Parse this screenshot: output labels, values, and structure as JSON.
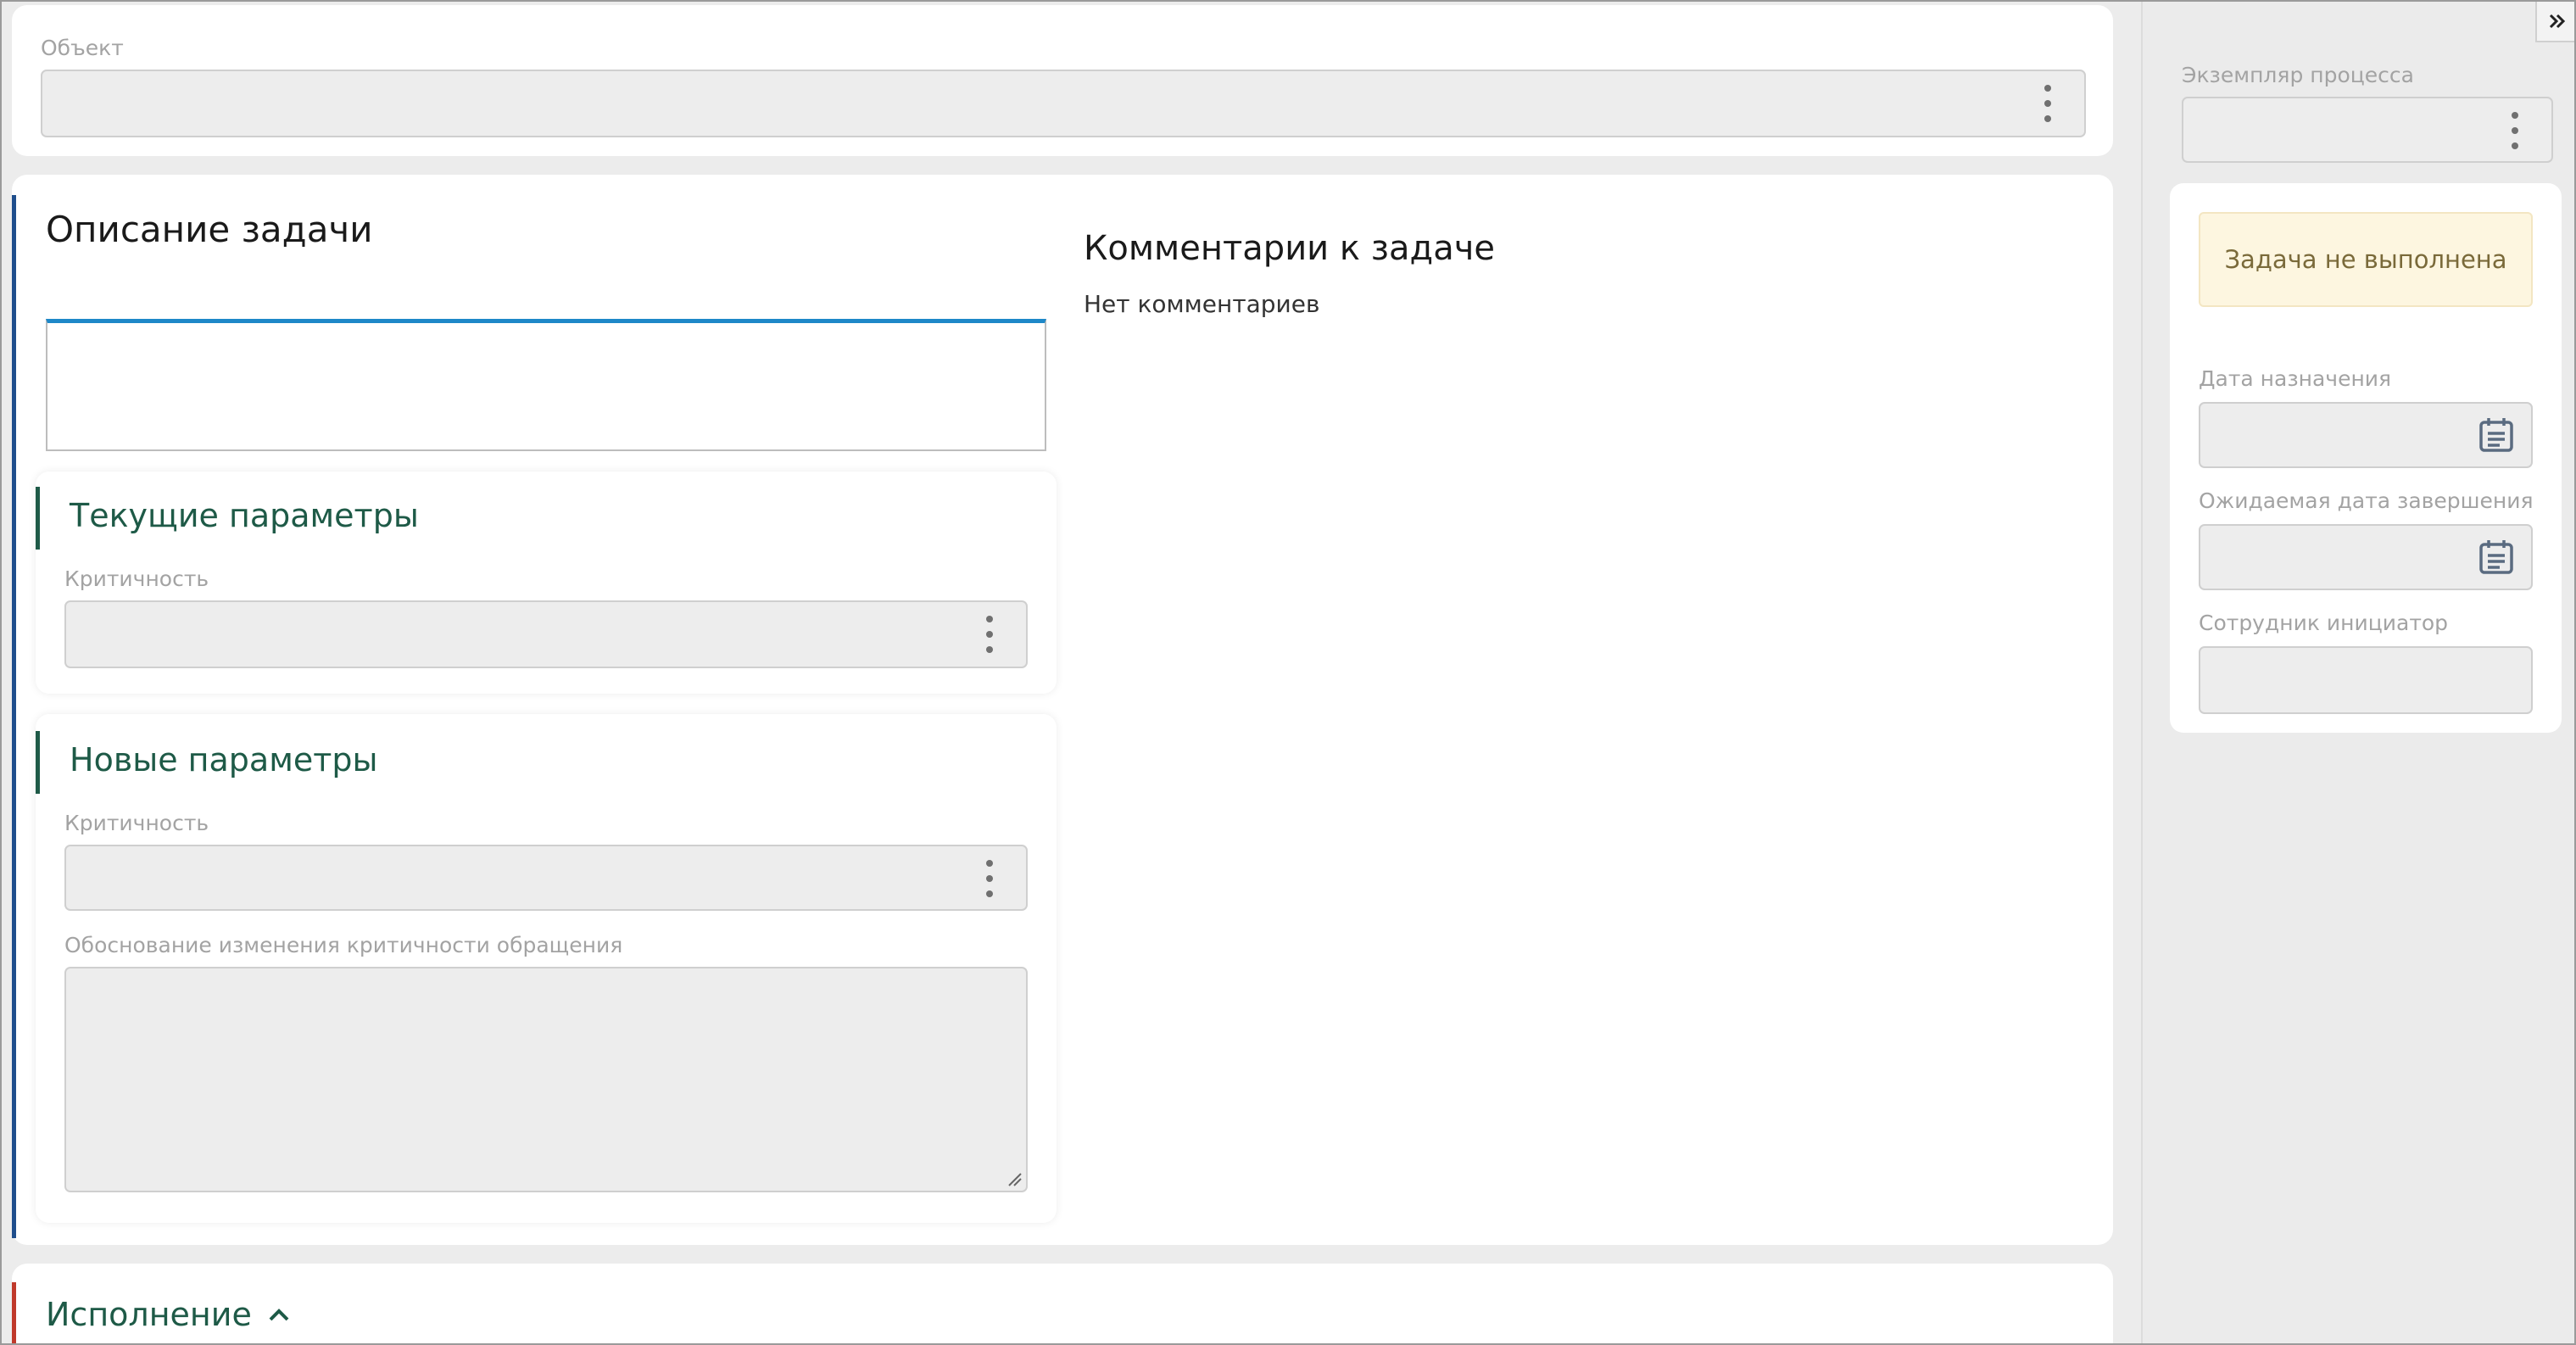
{
  "object": {
    "label": "Объект"
  },
  "task_description": {
    "title": "Описание задачи"
  },
  "comments": {
    "title": "Комментарии к задаче",
    "empty_text": "Нет комментариев"
  },
  "current_params": {
    "title": "Текущие параметры",
    "criticality_label": "Критичность"
  },
  "new_params": {
    "title": "Новые параметры",
    "criticality_label": "Критичность",
    "justification_label": "Обоснование изменения критичности обращения"
  },
  "execution": {
    "title": "Исполнение"
  },
  "sidebar": {
    "process_instance_label": "Экземпляр процесса",
    "status_text": "Задача не выполнена",
    "assign_date_label": "Дата назначения",
    "expected_end_label": "Ожидаемая дата завершения",
    "initiator_label": "Сотрудник инициатор"
  },
  "colors": {
    "accent_blue": "#1f4e8c",
    "accent_green": "#1e5a47",
    "accent_red": "#c0392b",
    "status_bg": "#fdf6e0"
  }
}
